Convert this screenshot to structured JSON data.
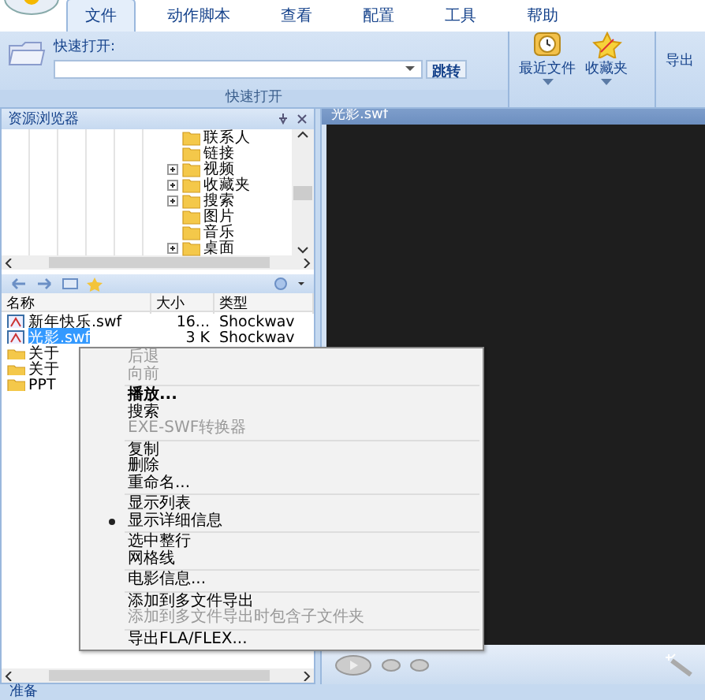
{
  "tabs": [
    {
      "label": "文件",
      "selected": true
    },
    {
      "label": "动作脚本",
      "selected": false
    },
    {
      "label": "查看",
      "selected": false
    },
    {
      "label": "配置",
      "selected": false
    },
    {
      "label": "工具",
      "selected": false
    },
    {
      "label": "帮助",
      "selected": false
    }
  ],
  "ribbon": {
    "quick_open_label": "快速打开:",
    "go_button": "跳转",
    "group_label": "快速打开",
    "buttons": [
      {
        "kind": "recent",
        "label": "最近文件"
      },
      {
        "kind": "favorites",
        "label": "收藏夹"
      },
      {
        "kind": "export",
        "label": "导出"
      }
    ]
  },
  "explorer": {
    "title": "资源浏览器",
    "tree": [
      {
        "label": "联系人",
        "expandable": false
      },
      {
        "label": "链接",
        "expandable": false
      },
      {
        "label": "视频",
        "expandable": true
      },
      {
        "label": "收藏夹",
        "expandable": true
      },
      {
        "label": "搜索",
        "expandable": true
      },
      {
        "label": "图片",
        "expandable": false
      },
      {
        "label": "音乐",
        "expandable": false
      },
      {
        "label": "桌面",
        "expandable": true
      }
    ],
    "columns": [
      "名称",
      "大小",
      "类型"
    ],
    "rows": [
      {
        "kind": "swf",
        "name": "新年快乐.swf",
        "size": "16...",
        "type": "Shockwav",
        "selected": false
      },
      {
        "kind": "swf",
        "name": "光影.swf",
        "size": "3 K",
        "type": "Shockwav",
        "selected": true
      },
      {
        "kind": "folder",
        "name": "关于",
        "selected": false
      },
      {
        "kind": "folder",
        "name": "关于",
        "selected": false
      },
      {
        "kind": "folder",
        "name": "PPT",
        "selected": false
      }
    ]
  },
  "context_menu": [
    {
      "kind": "item",
      "label": "后退",
      "disabled": true,
      "bold": false,
      "checked": false
    },
    {
      "kind": "item",
      "label": "向前",
      "disabled": true,
      "bold": false,
      "checked": false
    },
    {
      "kind": "separator"
    },
    {
      "kind": "item",
      "label": "播放...",
      "disabled": false,
      "bold": true,
      "checked": false
    },
    {
      "kind": "item",
      "label": "搜索",
      "disabled": false,
      "bold": false,
      "checked": false
    },
    {
      "kind": "item",
      "label": "EXE-SWF转换器",
      "disabled": true,
      "bold": false,
      "checked": false
    },
    {
      "kind": "separator"
    },
    {
      "kind": "item",
      "label": "复制",
      "disabled": false,
      "bold": false,
      "checked": false
    },
    {
      "kind": "item",
      "label": "删除",
      "disabled": false,
      "bold": false,
      "checked": false
    },
    {
      "kind": "item",
      "label": "重命名...",
      "disabled": false,
      "bold": false,
      "checked": false
    },
    {
      "kind": "separator"
    },
    {
      "kind": "item",
      "label": "显示列表",
      "disabled": false,
      "bold": false,
      "checked": false
    },
    {
      "kind": "item",
      "label": "显示详细信息",
      "disabled": false,
      "bold": false,
      "checked": true
    },
    {
      "kind": "separator"
    },
    {
      "kind": "item",
      "label": "选中整行",
      "disabled": false,
      "bold": false,
      "checked": false
    },
    {
      "kind": "item",
      "label": "网格线",
      "disabled": false,
      "bold": false,
      "checked": false
    },
    {
      "kind": "separator"
    },
    {
      "kind": "item",
      "label": "电影信息...",
      "disabled": false,
      "bold": false,
      "checked": false
    },
    {
      "kind": "separator"
    },
    {
      "kind": "item",
      "label": "添加到多文件导出",
      "disabled": false,
      "bold": false,
      "checked": false
    },
    {
      "kind": "item",
      "label": "添加到多文件导出时包含子文件夹",
      "disabled": true,
      "bold": false,
      "checked": false
    },
    {
      "kind": "separator"
    },
    {
      "kind": "item",
      "label": "导出FLA/FLEX...",
      "disabled": false,
      "bold": false,
      "checked": false
    }
  ],
  "viewer": {
    "title": "光影.swf"
  },
  "status_bar": "准备"
}
